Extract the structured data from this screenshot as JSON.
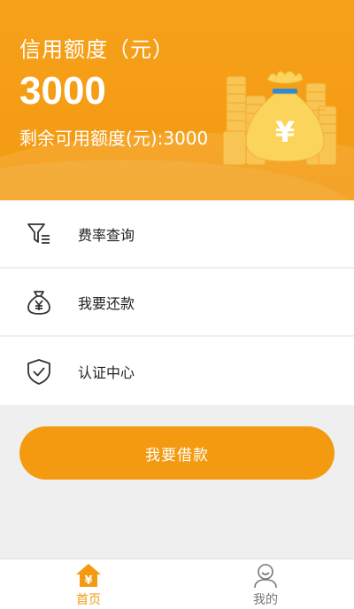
{
  "header": {
    "title": "信用额度（元）",
    "amount": "3000",
    "remaining": "剩余可用额度(元):3000"
  },
  "menu": {
    "items": [
      {
        "label": "费率查询",
        "icon": "filter-icon"
      },
      {
        "label": "我要还款",
        "icon": "money-bag-icon"
      },
      {
        "label": "认证中心",
        "icon": "shield-check-icon"
      }
    ]
  },
  "borrow_button": {
    "label": "我要借款"
  },
  "tabbar": {
    "tabs": [
      {
        "label": "首页",
        "icon": "home-icon",
        "active": true
      },
      {
        "label": "我的",
        "icon": "user-icon",
        "active": false
      }
    ]
  },
  "colors": {
    "accent": "#f39a10",
    "background": "#efefef",
    "text": "#222222"
  }
}
